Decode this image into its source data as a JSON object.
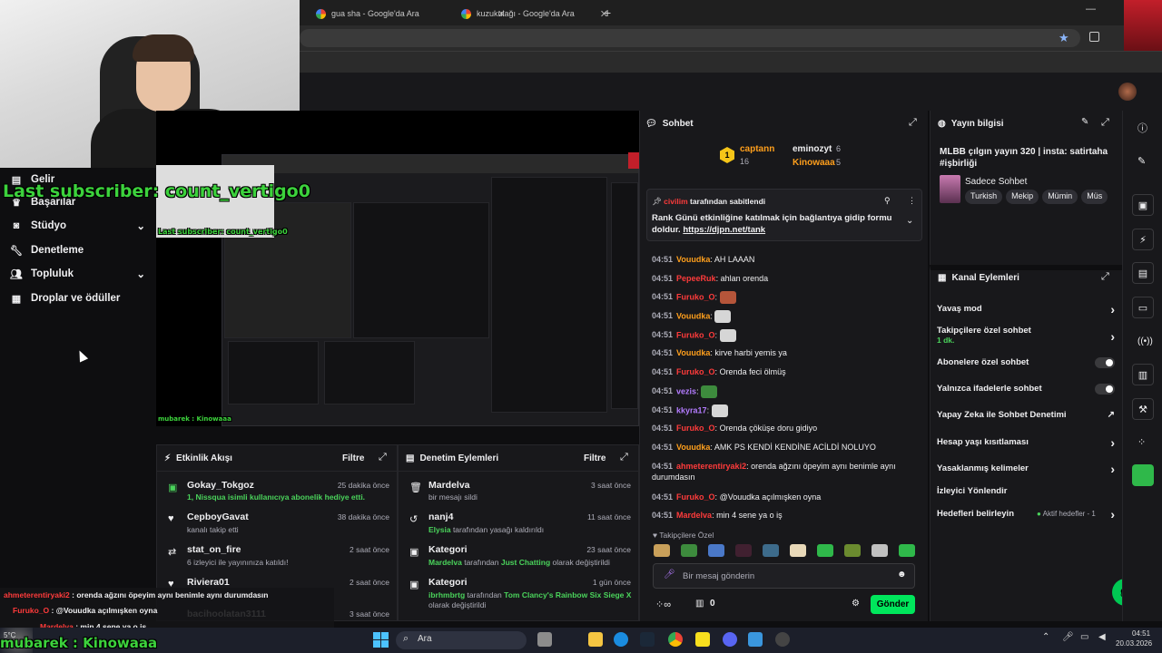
{
  "browser": {
    "tabs": [
      {
        "label": "gua sha - Google'da Ara"
      },
      {
        "label": "kuzukulağı - Google'da Ara"
      }
    ]
  },
  "overlay": {
    "last_subscriber": "Last subscriber: count_vertigo0",
    "last_subscriber_small": "Last subscriber: count_vertigo0",
    "bottom_name": "mubarek : Kinowaaa",
    "bottom_name_small": "mubarek : Kinowaaa"
  },
  "sidebar": {
    "items": [
      {
        "label": "Gelir"
      },
      {
        "label": "Başarılar"
      },
      {
        "label": "Stüdyo"
      },
      {
        "label": "Denetleme"
      },
      {
        "label": "Topluluk"
      },
      {
        "label": "Droplar ve ödüller"
      }
    ]
  },
  "activity": {
    "title": "Etkinlik Akışı",
    "filter": "Filtre",
    "rows": [
      {
        "name": "Gokay_Tokgoz",
        "sub": "1, Nissqua isimli kullanıcıya abonelik hediye etti.",
        "time": "25 dakika önce"
      },
      {
        "name": "CepboyGavat",
        "sub": "kanalı takip etti",
        "time": "38 dakika önce"
      },
      {
        "name": "stat_on_fire",
        "sub": "6 izleyici ile yayınınıza katıldı!",
        "time": "2 saat önce"
      },
      {
        "name": "Riviera01",
        "sub": "",
        "time": "2 saat önce"
      },
      {
        "name": "bacihoolatan3111",
        "sub": "",
        "time": "3 saat önce"
      }
    ]
  },
  "moderation": {
    "title": "Denetim Eylemleri",
    "filter": "Filtre",
    "rows": [
      {
        "name": "Mardelva",
        "sub": "bir mesajı sildi",
        "time": "3 saat önce"
      },
      {
        "name": "nanj4",
        "sub_user": "Elysia",
        "sub": " tarafından yasağı kaldırıldı",
        "time": "11 saat önce"
      },
      {
        "name": "Kategori",
        "sub_user": "Mardelva",
        "sub_mid": " tarafından ",
        "sub_cat": "Just Chatting",
        "sub": " olarak değiştirildi",
        "time": "23 saat önce"
      },
      {
        "name": "Kategori",
        "sub_user": "ibrhmbrtg",
        "sub_mid": " tarafından ",
        "sub_cat": "Tom Clancy's Rainbow Six Siege X",
        "sub": " olarak değiştirildi",
        "time": "1 gün önce"
      }
    ]
  },
  "chat": {
    "title": "Sohbet",
    "leaders": [
      {
        "name": "captann",
        "count": "16"
      },
      {
        "name": "eminozyt",
        "count": "6"
      },
      {
        "name": "Kinowaaa",
        "count": "5"
      }
    ],
    "pinned": {
      "user": "civilim",
      "by": " tarafından sabitlendi",
      "text": "Rank Günü etkinliğine katılmak için bağlantıya gidip formu doldur.",
      "link": "https://djpn.net/tank"
    },
    "messages": [
      {
        "time": "04:51",
        "user": "Vouudka",
        "text": "AH LAAAN"
      },
      {
        "time": "04:51",
        "user": "PepeeRuk",
        "text": "ahlan orenda"
      },
      {
        "time": "04:51",
        "user": "Furuko_O",
        "text": ""
      },
      {
        "time": "04:51",
        "user": "Vouudka",
        "text": ""
      },
      {
        "time": "04:51",
        "user": "Furuko_O",
        "text": ""
      },
      {
        "time": "04:51",
        "user": "Vouudka",
        "text": "kirve harbi yemis ya"
      },
      {
        "time": "04:51",
        "user": "Furuko_O",
        "text": "Orenda feci ölmüş"
      },
      {
        "time": "04:51",
        "user": "vezis",
        "text": ""
      },
      {
        "time": "04:51",
        "user": "kkyra17",
        "text": ""
      },
      {
        "time": "04:51",
        "user": "Furuko_O",
        "text": "Orenda çöküşe doru gidiyo"
      },
      {
        "time": "04:51",
        "user": "Vouudka",
        "text": "AMK PS KENDİ KENDİNE ACİLDİ NOLUYO"
      },
      {
        "time": "04:51",
        "user": "ahmeterentiryaki2",
        "text": "orenda ağzını öpeyim aynı benimle aynı durumdasın"
      },
      {
        "time": "04:51",
        "user": "Furuko_O",
        "text": "@Vouudka açılmışken oyna"
      },
      {
        "time": "04:51",
        "user": "Mardelva",
        "text": "min 4 sene ya o iş"
      }
    ],
    "followers_only": "Takipçilere Özel",
    "input_placeholder": "Bir mesaj gönderin",
    "points": "0",
    "send": "Gönder"
  },
  "stream_info": {
    "title": "Yayın bilgisi",
    "stream_title": "MLBB çılgın yayın 320 | insta: satirtaha #işbirliği",
    "category": "Sadece Sohbet",
    "tags": [
      "Turkish",
      "Mekip",
      "Mümin",
      "Müs"
    ]
  },
  "channel_actions": {
    "title": "Kanal Eylemleri",
    "items": [
      {
        "label": "Yavaş mod",
        "kind": "arrow"
      },
      {
        "label": "Takipçilere özel sohbet",
        "sub": "1 dk.",
        "kind": "arrow"
      },
      {
        "label": "Abonelere özel sohbet",
        "kind": "toggle"
      },
      {
        "label": "Yalnızca ifadelerle sohbet",
        "kind": "toggle"
      },
      {
        "label": "Yapay Zeka ile Sohbet Denetimi",
        "kind": "external"
      },
      {
        "label": "Hesap yaşı kısıtlaması",
        "kind": "arrow"
      },
      {
        "label": "Yasaklanmış kelimeler",
        "kind": "arrow"
      },
      {
        "label": "İzleyici Yönlendir",
        "kind": "none"
      },
      {
        "label": "Hedefleri belirleyin",
        "extra": "Aktif hedefler - 1",
        "kind": "arrow"
      }
    ]
  },
  "overlay_chat": [
    {
      "user": "ahmeterentiryaki2",
      "text": "orenda ağzını öpeyim aynı benimle aynı durumdasın"
    },
    {
      "user": "Furuko_O",
      "text": "@Vouudka açılmışken oyna"
    },
    {
      "user": "Mardelva",
      "text": "min 4 sene ya o iş"
    }
  ],
  "taskbar": {
    "search": "Ara",
    "clock": "04:51",
    "date": "20.03.2026",
    "weather": "5°C"
  },
  "colors": {
    "accent_green": "#00e65c",
    "overlay_green": "#3cd23c",
    "bg": "#0e0e10",
    "panel": "#18181b"
  }
}
